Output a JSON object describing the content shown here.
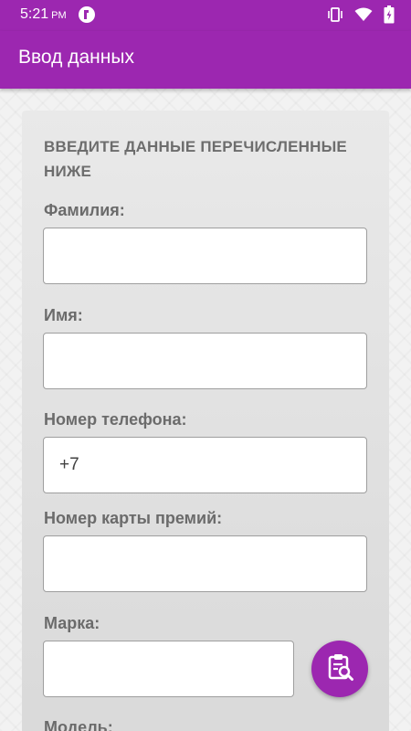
{
  "status_bar": {
    "time": "5:21",
    "ampm": "PM",
    "icons": [
      "notification-icon",
      "vibrate-icon",
      "wifi-icon",
      "battery-icon"
    ]
  },
  "app_bar": {
    "title": "Ввод данных"
  },
  "form": {
    "heading": "ВВЕДИТЕ ДАННЫЕ ПЕРЕЧИСЛЕННЫЕ НИЖЕ",
    "surname_label": "Фамилия:",
    "surname_value": "",
    "name_label": "Имя:",
    "name_value": "",
    "phone_label": "Номер телефона:",
    "phone_value": "+7",
    "card_label": "Номер карты премий:",
    "card_value": "",
    "brand_label": "Марка:",
    "brand_value": "",
    "model_label": "Модель:",
    "scan_icon": "clipboard-search-icon"
  },
  "colors": {
    "primary": "#9c27b0",
    "card_background": "#e3e3e3",
    "label_text": "#6b6b6b"
  }
}
